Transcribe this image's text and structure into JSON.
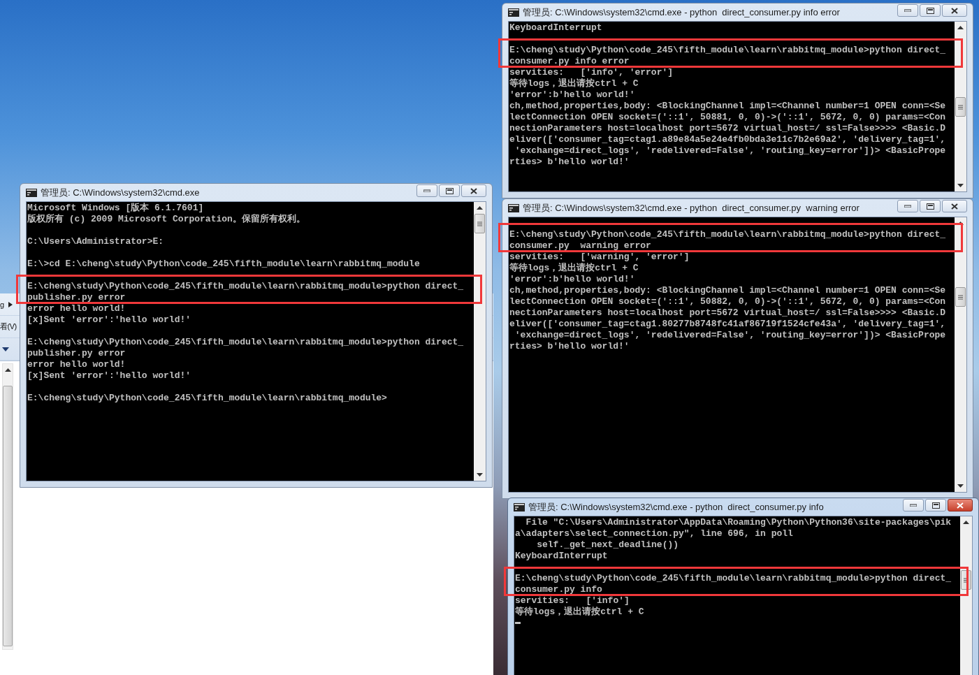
{
  "background_window": {
    "menu_items": [
      {
        "label": "g"
      },
      {
        "label": "看(V)"
      }
    ]
  },
  "windows": [
    {
      "title": "管理员: C:\\Windows\\system32\\cmd.exe",
      "active": false,
      "lines": [
        {
          "kind": "text",
          "text": "Microsoft Windows [版本 6.1.7601]",
          "highlighted": false
        },
        {
          "kind": "text",
          "text": "版权所有 (c) 2009 Microsoft Corporation。保留所有权利。",
          "highlighted": false
        },
        {
          "kind": "blank"
        },
        {
          "kind": "text",
          "text": "C:\\Users\\Administrator>E:",
          "highlighted": false
        },
        {
          "kind": "blank"
        },
        {
          "kind": "text",
          "text": "E:\\>cd E:\\cheng\\study\\Python\\code_245\\fifth_module\\learn\\rabbitmq_module",
          "highlighted": false
        },
        {
          "kind": "blank"
        },
        {
          "kind": "text",
          "text": "E:\\cheng\\study\\Python\\code_245\\fifth_module\\learn\\rabbitmq_module>python direct_",
          "highlighted": true
        },
        {
          "kind": "text",
          "text": "publisher.py error",
          "highlighted": true
        },
        {
          "kind": "text",
          "text": "error hello world!",
          "highlighted": false
        },
        {
          "kind": "text",
          "text": "[x]Sent 'error':'hello world!'",
          "highlighted": false
        },
        {
          "kind": "blank"
        },
        {
          "kind": "text",
          "text": "E:\\cheng\\study\\Python\\code_245\\fifth_module\\learn\\rabbitmq_module>python direct_",
          "highlighted": false
        },
        {
          "kind": "text",
          "text": "publisher.py error",
          "highlighted": false
        },
        {
          "kind": "text",
          "text": "error hello world!",
          "highlighted": false
        },
        {
          "kind": "text",
          "text": "[x]Sent 'error':'hello world!'",
          "highlighted": false
        },
        {
          "kind": "blank"
        },
        {
          "kind": "text",
          "text": "E:\\cheng\\study\\Python\\code_245\\fifth_module\\learn\\rabbitmq_module>",
          "highlighted": false
        }
      ]
    },
    {
      "title": "管理员: C:\\Windows\\system32\\cmd.exe - python  direct_consumer.py info error",
      "active": false,
      "lines": [
        {
          "kind": "text",
          "text": "KeyboardInterrupt",
          "highlighted": false
        },
        {
          "kind": "blank"
        },
        {
          "kind": "text",
          "text": "E:\\cheng\\study\\Python\\code_245\\fifth_module\\learn\\rabbitmq_module>python direct_",
          "highlighted": true
        },
        {
          "kind": "text",
          "text": "consumer.py info error",
          "highlighted": true
        },
        {
          "kind": "text",
          "text": "servities:   ['info', 'error']",
          "highlighted": false
        },
        {
          "kind": "text",
          "text": "等待logs，退出请按ctrl + C",
          "highlighted": false
        },
        {
          "kind": "text",
          "text": "'error':b'hello world!'",
          "highlighted": false
        },
        {
          "kind": "text",
          "text": "ch,method,properties,body: <BlockingChannel impl=<Channel number=1 OPEN conn=<Se",
          "highlighted": false
        },
        {
          "kind": "text",
          "text": "lectConnection OPEN socket=('::1', 50881, 0, 0)->('::1', 5672, 0, 0) params=<Con",
          "highlighted": false
        },
        {
          "kind": "text",
          "text": "nectionParameters host=localhost port=5672 virtual_host=/ ssl=False>>>> <Basic.D",
          "highlighted": false
        },
        {
          "kind": "text",
          "text": "eliver(['consumer_tag=ctag1.a89e84a5e24e4fb0bda3e11c7b2e69a2', 'delivery_tag=1',",
          "highlighted": false
        },
        {
          "kind": "text",
          "text": " 'exchange=direct_logs', 'redelivered=False', 'routing_key=error'])> <BasicPrope",
          "highlighted": false
        },
        {
          "kind": "text",
          "text": "rties> b'hello world!'",
          "highlighted": false
        }
      ]
    },
    {
      "title": "管理员: C:\\Windows\\system32\\cmd.exe - python  direct_consumer.py  warning error",
      "active": false,
      "lines": [
        {
          "kind": "blank"
        },
        {
          "kind": "text",
          "text": "E:\\cheng\\study\\Python\\code_245\\fifth_module\\learn\\rabbitmq_module>python direct_",
          "highlighted": true
        },
        {
          "kind": "text",
          "text": "consumer.py  warning error",
          "highlighted": true
        },
        {
          "kind": "text",
          "text": "servities:   ['warning', 'error']",
          "highlighted": false
        },
        {
          "kind": "text",
          "text": "等待logs，退出请按ctrl + C",
          "highlighted": false
        },
        {
          "kind": "text",
          "text": "'error':b'hello world!'",
          "highlighted": false
        },
        {
          "kind": "text",
          "text": "ch,method,properties,body: <BlockingChannel impl=<Channel number=1 OPEN conn=<Se",
          "highlighted": false
        },
        {
          "kind": "text",
          "text": "lectConnection OPEN socket=('::1', 50882, 0, 0)->('::1', 5672, 0, 0) params=<Con",
          "highlighted": false
        },
        {
          "kind": "text",
          "text": "nectionParameters host=localhost port=5672 virtual_host=/ ssl=False>>>> <Basic.D",
          "highlighted": false
        },
        {
          "kind": "text",
          "text": "eliver(['consumer_tag=ctag1.80277b8748fc41af86719f1524cfe43a', 'delivery_tag=1',",
          "highlighted": false
        },
        {
          "kind": "text",
          "text": " 'exchange=direct_logs', 'redelivered=False', 'routing_key=error'])> <BasicPrope",
          "highlighted": false
        },
        {
          "kind": "text",
          "text": "rties> b'hello world!'",
          "highlighted": false
        }
      ]
    },
    {
      "title": "管理员: C:\\Windows\\system32\\cmd.exe - python  direct_consumer.py info",
      "active": true,
      "lines": [
        {
          "kind": "text",
          "text": "  File \"C:\\Users\\Administrator\\AppData\\Roaming\\Python\\Python36\\site-packages\\pik",
          "highlighted": false
        },
        {
          "kind": "text",
          "text": "a\\adapters\\select_connection.py\", line 696, in poll",
          "highlighted": false
        },
        {
          "kind": "text",
          "text": "    self._get_next_deadline())",
          "highlighted": false
        },
        {
          "kind": "text",
          "text": "KeyboardInterrupt",
          "highlighted": false
        },
        {
          "kind": "blank"
        },
        {
          "kind": "text",
          "text": "E:\\cheng\\study\\Python\\code_245\\fifth_module\\learn\\rabbitmq_module>python direct_",
          "highlighted": true
        },
        {
          "kind": "text",
          "text": "consumer.py info",
          "highlighted": true
        },
        {
          "kind": "text",
          "text": "servities:   ['info']",
          "highlighted": false
        },
        {
          "kind": "text",
          "text": "等待logs，退出请按ctrl + C",
          "highlighted": false
        },
        {
          "kind": "cursor"
        }
      ]
    }
  ]
}
